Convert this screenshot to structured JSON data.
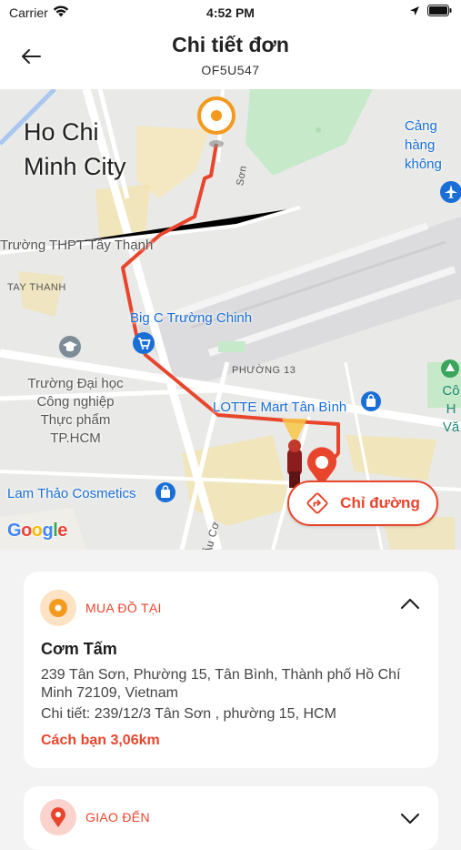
{
  "status_bar": {
    "carrier": "Carrier",
    "time": "4:52 PM"
  },
  "header": {
    "title": "Chi tiết đơn",
    "order_code": "OF5U547"
  },
  "map": {
    "labels": {
      "city": "Ho Chi Minh City",
      "airport": "Cảng hàng không Quốc tế Tân Sơn",
      "school": "Trường THPT Tây Thạnh",
      "ward_tay_thanh": "TAY THANH",
      "big_c": "Big C Trường Chinh",
      "ward_13": "PHƯỜNG 13",
      "university": "Trường Đại học Công nghiệp Thực phẩm TP.HCM",
      "lotte": "LOTTE Mart Tân Bình",
      "cosmetics": "Lam Thảo Cosmetics",
      "right_poi": "Cô H Vă",
      "street_son": "Sơn",
      "street_au_co": "Âu Cơ"
    },
    "google_logo": "Google",
    "directions_label": "Chỉ đường",
    "colors": {
      "route": "#e8452c",
      "origin": "#f39a1e",
      "accent": "#e8452c"
    }
  },
  "pickup": {
    "section_title": "MUA ĐỒ TẠI",
    "name": "Cơm Tấm",
    "address": "239 Tân Sơn, Phường 15, Tân Bình, Thành phố Hồ Chí Minh 72109, Vietnam",
    "detail": "Chi tiết: 239/12/3 Tân Sơn , phường 15, HCM",
    "distance": "Cách bạn 3,06km"
  },
  "delivery": {
    "section_title": "GIAO ĐẾN"
  }
}
